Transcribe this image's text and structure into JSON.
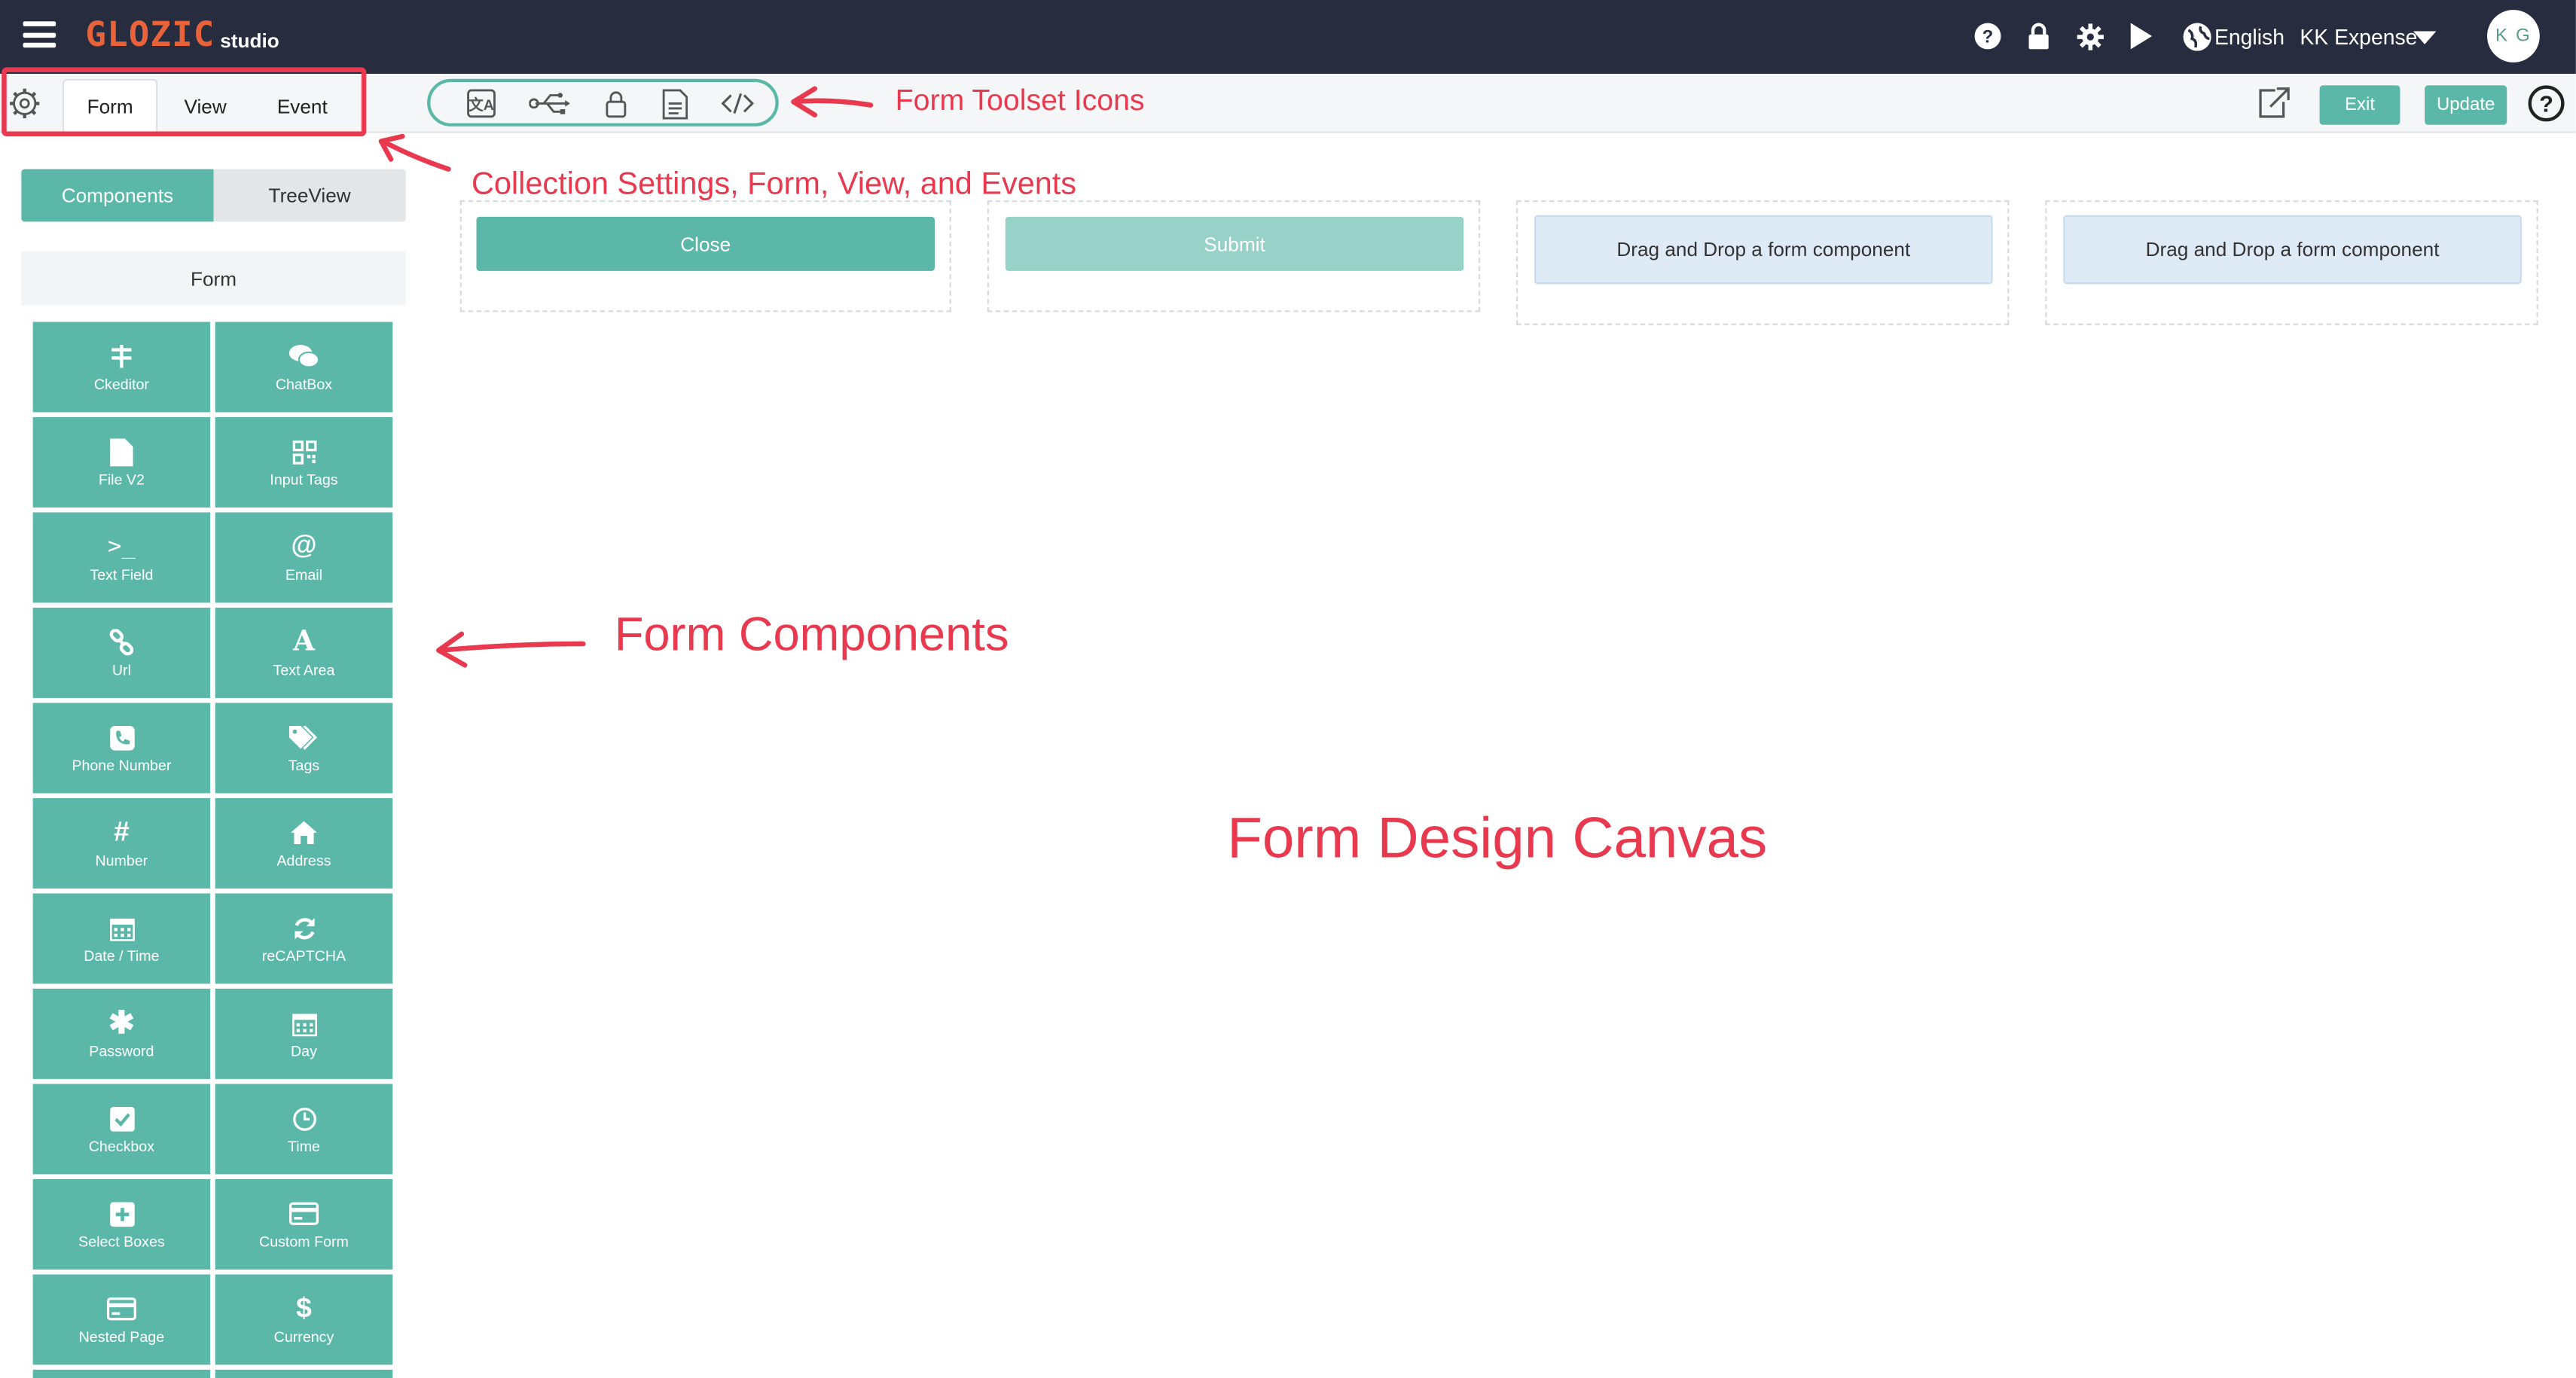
{
  "header": {
    "logo_main": "GLOZIC",
    "logo_sub": "studio",
    "language": "English",
    "project": "KK Expense",
    "avatar_initials": "K G"
  },
  "subbar": {
    "tabs": [
      {
        "label": "Form",
        "active": true
      },
      {
        "label": "View",
        "active": false
      },
      {
        "label": "Event",
        "active": false
      }
    ],
    "exit_label": "Exit",
    "update_label": "Update"
  },
  "sidebar": {
    "segment_components": "Components",
    "segment_treeview": "TreeView",
    "section_title": "Form",
    "components": [
      {
        "label": "Ckeditor",
        "icon": "ckeditor-icon"
      },
      {
        "label": "ChatBox",
        "icon": "chat-icon"
      },
      {
        "label": "File V2",
        "icon": "file-icon"
      },
      {
        "label": "Input Tags",
        "icon": "qr-icon"
      },
      {
        "label": "Text Field",
        "icon": "terminal-icon"
      },
      {
        "label": "Email",
        "icon": "at-icon"
      },
      {
        "label": "Url",
        "icon": "link-icon"
      },
      {
        "label": "Text Area",
        "icon": "font-icon"
      },
      {
        "label": "Phone Number",
        "icon": "phone-icon"
      },
      {
        "label": "Tags",
        "icon": "tags-icon"
      },
      {
        "label": "Number",
        "icon": "hash-icon"
      },
      {
        "label": "Address",
        "icon": "home-icon"
      },
      {
        "label": "Date / Time",
        "icon": "calendar-icon"
      },
      {
        "label": "reCAPTCHA",
        "icon": "refresh-icon"
      },
      {
        "label": "Password",
        "icon": "asterisk-icon"
      },
      {
        "label": "Day",
        "icon": "calendar-icon"
      },
      {
        "label": "Checkbox",
        "icon": "checkbox-icon"
      },
      {
        "label": "Time",
        "icon": "clock-icon"
      },
      {
        "label": "Select Boxes",
        "icon": "plus-square-icon"
      },
      {
        "label": "Custom Form",
        "icon": "card-icon"
      },
      {
        "label": "Nested Page",
        "icon": "card-icon"
      },
      {
        "label": "Currency",
        "icon": "dollar-icon"
      }
    ]
  },
  "canvas": {
    "close_label": "Close",
    "submit_label": "Submit",
    "drop_label_1": "Drag and Drop a form component",
    "drop_label_2": "Drag and Drop a form component"
  },
  "annotations": {
    "toolset": "Form Toolset Icons",
    "collection": "Collection Settings, Form, View, and Events",
    "components": "Form Components",
    "canvas": "Form Design Canvas"
  },
  "colors": {
    "topbar": "#272d3f",
    "accent": "#5bb8a8",
    "annotation": "#e8394f",
    "logo": "#e8623a"
  }
}
